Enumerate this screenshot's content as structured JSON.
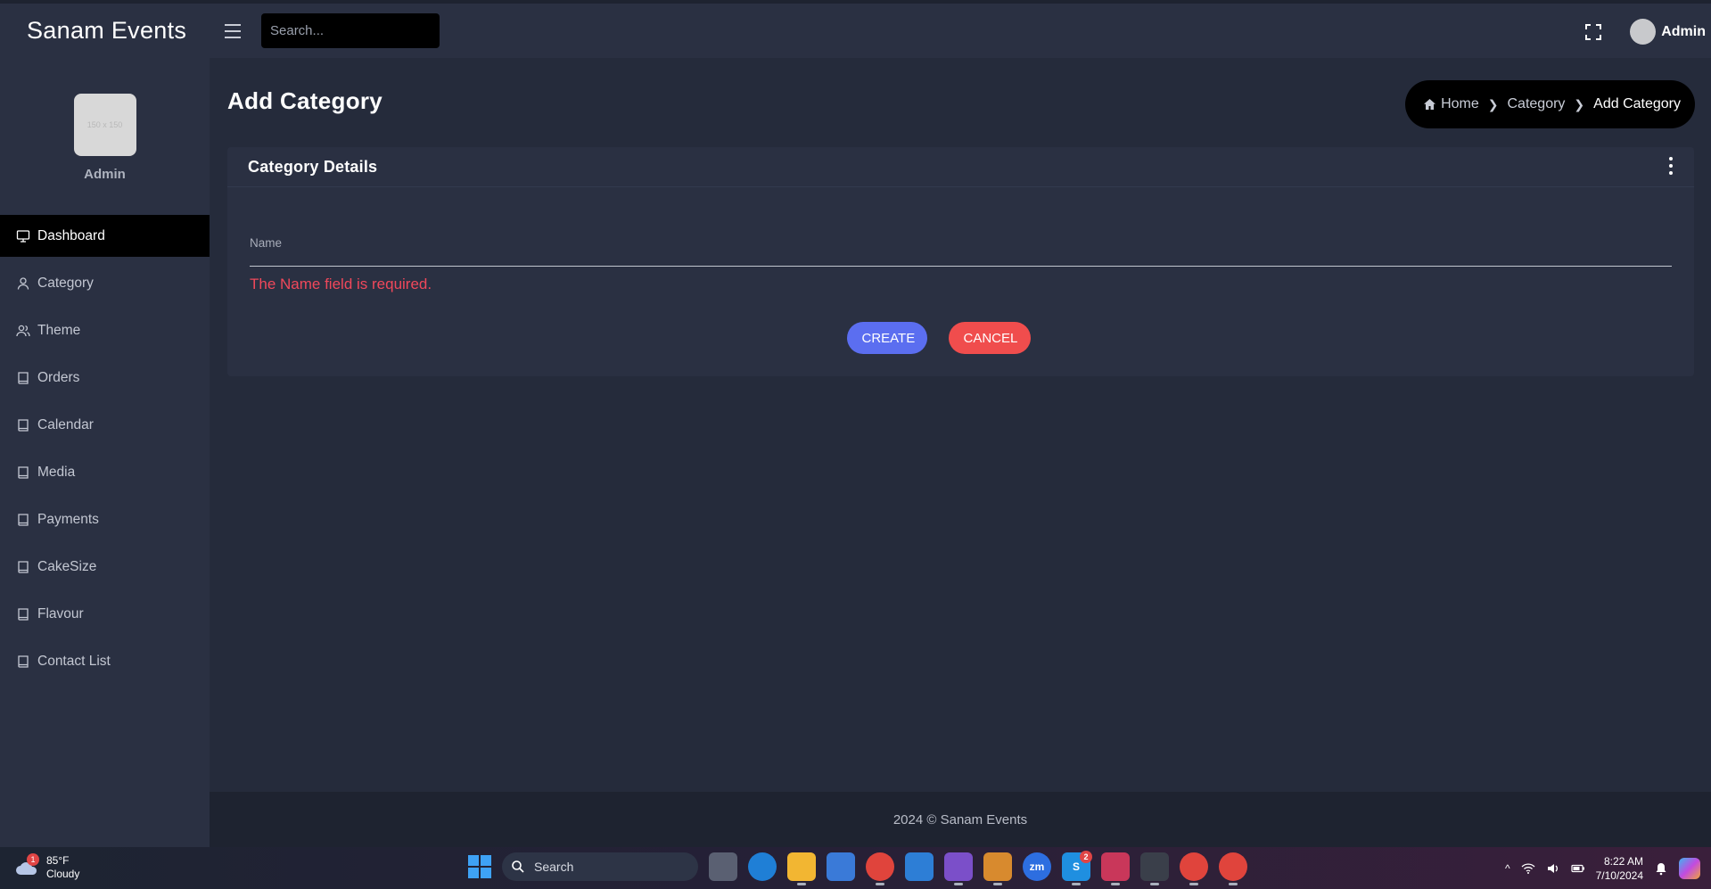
{
  "header": {
    "brand": "Sanam Events",
    "search_placeholder": "Search...",
    "user_name": "Admin"
  },
  "sidebar": {
    "profile_image_text": "150 x 150",
    "profile_name": "Admin",
    "items": [
      {
        "label": "Dashboard",
        "icon": "monitor-icon",
        "active": true
      },
      {
        "label": "Category",
        "icon": "user-icon"
      },
      {
        "label": "Theme",
        "icon": "users-icon"
      },
      {
        "label": "Orders",
        "icon": "book-icon"
      },
      {
        "label": "Calendar",
        "icon": "book-icon"
      },
      {
        "label": "Media",
        "icon": "book-icon"
      },
      {
        "label": "Payments",
        "icon": "book-icon"
      },
      {
        "label": "CakeSize",
        "icon": "book-icon"
      },
      {
        "label": "Flavour",
        "icon": "book-icon"
      },
      {
        "label": "Contact List",
        "icon": "book-icon"
      }
    ]
  },
  "page": {
    "title": "Add Category",
    "breadcrumb": {
      "home": "Home",
      "category": "Category",
      "current": "Add Category"
    }
  },
  "form": {
    "card_title": "Category Details",
    "name_label": "Name",
    "name_value": "",
    "name_error": "The Name field is required.",
    "create_label": "CREATE",
    "cancel_label": "CANCEL"
  },
  "footer": {
    "text": "2024 © Sanam Events"
  },
  "taskbar": {
    "weather_temp": "85°F",
    "weather_desc": "Cloudy",
    "weather_badge": "1",
    "search_label": "Search",
    "skype_badge": "2",
    "time": "8:22 AM",
    "date": "7/10/2024"
  },
  "colors": {
    "background": "#252b3b",
    "panel": "#2a3042",
    "create": "#5b6ef0",
    "cancel": "#f04d4d",
    "error": "#f0485b"
  }
}
